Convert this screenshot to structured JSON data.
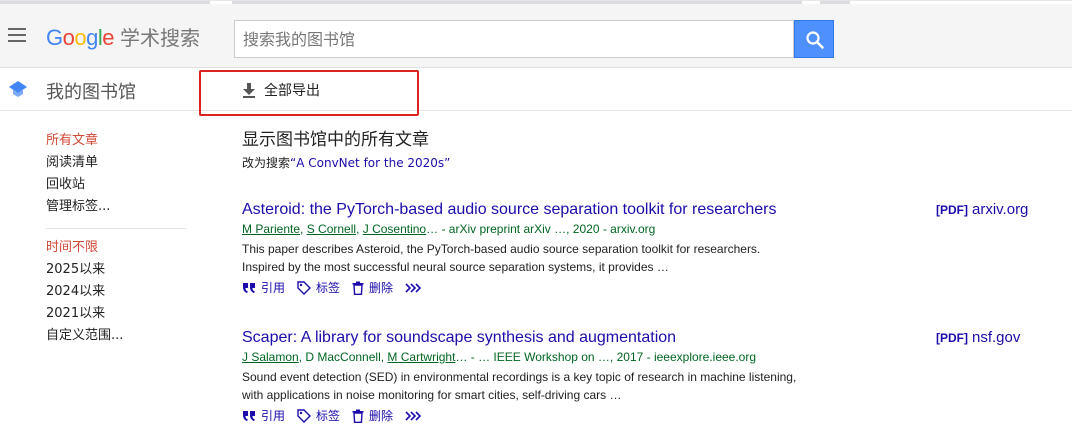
{
  "header": {
    "logo_letters": [
      "G",
      "o",
      "o",
      "g",
      "l",
      "e"
    ],
    "logo_suffix": "学术搜索",
    "search_placeholder": "搜索我的图书馆"
  },
  "subheader": {
    "library_title": "我的图书馆",
    "export_label": "全部导出"
  },
  "sidebar": {
    "section1": [
      "所有文章",
      "阅读清单",
      "回收站",
      "管理标签..."
    ],
    "section2": [
      "时间不限",
      "2025以来",
      "2024以来",
      "2021以来",
      "自定义范围..."
    ]
  },
  "main": {
    "title": "显示图书馆中的所有文章",
    "change_prefix": "改为搜索",
    "change_query": "“A ConvNet for the 2020s”"
  },
  "results": [
    {
      "title": "Asteroid: the PyTorch-based audio source separation toolkit for researchers",
      "authors": [
        "M Pariente",
        "S Cornell",
        "J Cosentino"
      ],
      "authors_tail": "… - arXiv preprint arXiv …, 2020 - arxiv.org",
      "snippet": "This paper describes Asteroid, the PyTorch-based audio source separation toolkit for researchers. Inspired by the most successful neural source separation systems, it provides …",
      "side_pdf": "[PDF]",
      "side_source": "arxiv.org"
    },
    {
      "title": "Scaper: A library for soundscape synthesis and augmentation",
      "authors": [
        "J Salamon",
        "D MacConnell",
        "M Cartwright"
      ],
      "authors_tail": "… - … IEEE Workshop on …, 2017 - ieeexplore.ieee.org",
      "snippet": "Sound event detection (SED) in environmental recordings is a key topic of research in machine listening, with applications in noise monitoring for smart cities, self-driving cars …",
      "side_pdf": "[PDF]",
      "side_source": "nsf.gov"
    }
  ],
  "actions": {
    "cite": "引用",
    "label": "标签",
    "delete": "删除"
  },
  "icons": [
    "menu-icon",
    "search-icon",
    "library-icon",
    "download-icon",
    "quote-icon",
    "tag-icon",
    "trash-icon",
    "more-icon"
  ],
  "colors": {
    "link": "#1a0dab",
    "green": "#006621",
    "active": "#d14836",
    "search_button": "#4d90fe",
    "highlight_box": "#dd2222"
  }
}
